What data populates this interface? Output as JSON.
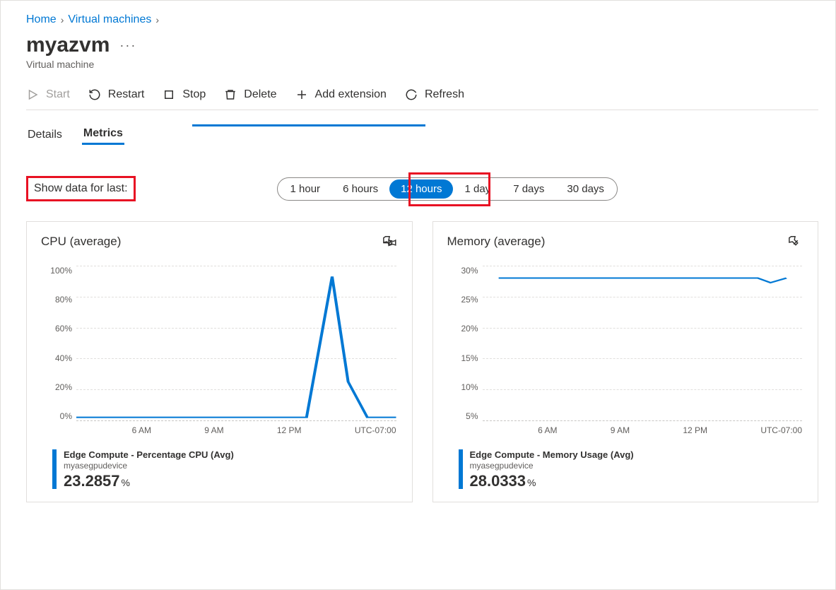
{
  "breadcrumb": {
    "home": "Home",
    "vms": "Virtual machines"
  },
  "header": {
    "title": "myazvm",
    "subtitle": "Virtual machine"
  },
  "toolbar": {
    "start": "Start",
    "restart": "Restart",
    "stop": "Stop",
    "delete": "Delete",
    "addext": "Add extension",
    "refresh": "Refresh"
  },
  "tabs": {
    "details": "Details",
    "metrics": "Metrics"
  },
  "filter": {
    "label": "Show data for last:",
    "options": [
      "1 hour",
      "6 hours",
      "12 hours",
      "1 day",
      "7 days",
      "30 days"
    ],
    "selected": "12 hours"
  },
  "chart_data": [
    {
      "type": "line",
      "title": "CPU (average)",
      "ylabel": "",
      "ylim": [
        0,
        100
      ],
      "yticks": [
        "100%",
        "80%",
        "60%",
        "40%",
        "20%",
        "0%"
      ],
      "xticks": [
        "6 AM",
        "9 AM",
        "12 PM",
        "UTC-07:00"
      ],
      "series": [
        {
          "name": "Edge Compute - Percentage CPU (Avg)",
          "device": "myasegpudevice",
          "x": [
            0,
            1,
            2,
            3,
            4,
            5,
            6,
            7,
            8,
            9,
            10,
            11
          ],
          "values": [
            2,
            2,
            2,
            2,
            2,
            2,
            2,
            2,
            2,
            93,
            25,
            2
          ],
          "summary": "23.2857",
          "unit": "%"
        }
      ],
      "color": "#0078d4"
    },
    {
      "type": "line",
      "title": "Memory (average)",
      "ylabel": "",
      "ylim": [
        0,
        30
      ],
      "yticks": [
        "30%",
        "25%",
        "20%",
        "15%",
        "10%",
        "5%"
      ],
      "xticks": [
        "6 AM",
        "9 AM",
        "12 PM",
        "UTC-07:00"
      ],
      "series": [
        {
          "name": "Edge Compute - Memory Usage (Avg)",
          "device": "myasegpudevice",
          "x": [
            0,
            1,
            2,
            3,
            4,
            5,
            6,
            7,
            8,
            9,
            10,
            11
          ],
          "values": [
            28,
            28,
            28,
            28,
            28,
            28,
            28,
            28,
            28,
            28,
            27.5,
            28
          ],
          "summary": "28.0333",
          "unit": "%"
        }
      ],
      "color": "#0078d4"
    }
  ]
}
